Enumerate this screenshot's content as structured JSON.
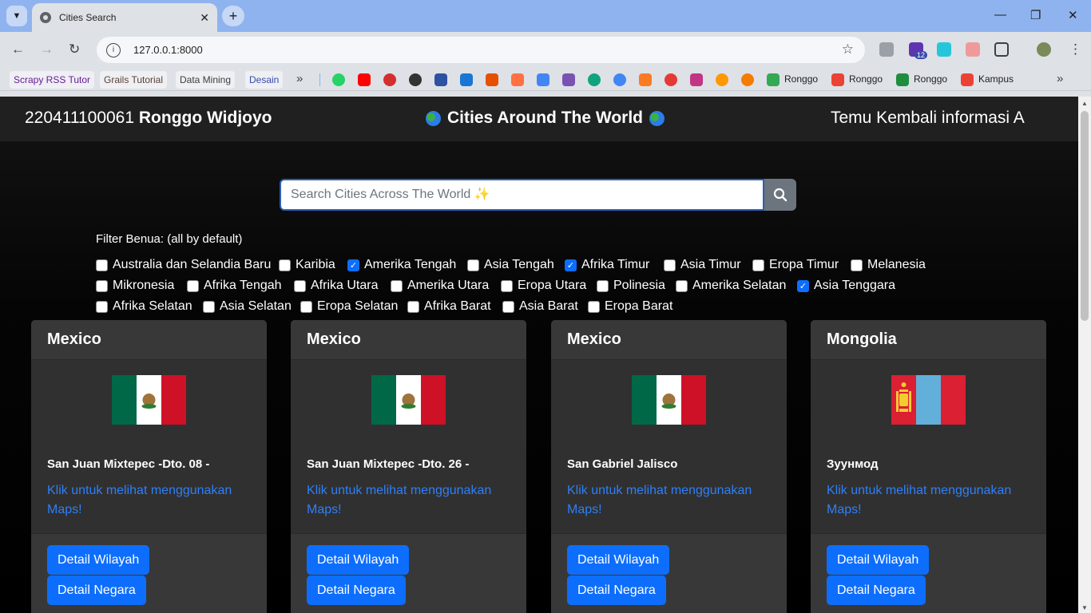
{
  "browser": {
    "tab_title": "Cities Search",
    "url": "127.0.0.1:8000",
    "extension_badge": "12",
    "bookmarks": [
      {
        "label": "Scrapy RSS Tutor",
        "color": "#6a1b9a"
      },
      {
        "label": "Grails Tutorial",
        "color": "#5d4037"
      },
      {
        "label": "Data Mining",
        "color": "#3c4043"
      },
      {
        "label": "Desain",
        "color": "#3949ab"
      }
    ],
    "bookmark_icons": [
      {
        "name": "whatsapp-icon",
        "color": "#25d366"
      },
      {
        "name": "youtube-icon",
        "color": "#ff0000"
      },
      {
        "name": "851-icon",
        "color": "#d32f2f"
      },
      {
        "name": "github-icon",
        "color": "#333333"
      },
      {
        "name": "mal-icon",
        "color": "#2e51a2"
      },
      {
        "name": "blue-app-icon",
        "color": "#1976d2"
      },
      {
        "name": "ppa-icon",
        "color": "#e65100"
      },
      {
        "name": "orange-icon",
        "color": "#ff7043"
      },
      {
        "name": "translate-icon",
        "color": "#4285f4"
      },
      {
        "name": "bootstrap-icon",
        "color": "#7952b3"
      },
      {
        "name": "chatgpt-icon",
        "color": "#10a37f"
      },
      {
        "name": "gemini-icon",
        "color": "#4285f4"
      },
      {
        "name": "xampp-icon",
        "color": "#fb7a24"
      },
      {
        "name": "laravel-icon",
        "color": "#e53935"
      },
      {
        "name": "instagram-icon",
        "color": "#c13584"
      },
      {
        "name": "circles-icon",
        "color": "#ff9800"
      },
      {
        "name": "co-icon",
        "color": "#f57c00"
      }
    ],
    "profile_bookmarks": [
      {
        "label": "Ronggo",
        "icon": "drive-icon",
        "color": "#34a853"
      },
      {
        "label": "Ronggo",
        "icon": "gmail-icon",
        "color": "#ea4335"
      },
      {
        "label": "Ronggo",
        "icon": "classroom-icon",
        "color": "#1e8e3e"
      },
      {
        "label": "Kampus",
        "icon": "gmail-icon",
        "color": "#ea4335"
      }
    ]
  },
  "header": {
    "student_id": "220411100061",
    "student_name": "Ronggo Widjoyo",
    "title": "Cities Around The World",
    "right_text": "Temu Kembali informasi A"
  },
  "search": {
    "placeholder": "Search Cities Across The World ✨"
  },
  "filter": {
    "label": "Filter Benua: (all by default)",
    "options": [
      {
        "label": "Australia dan Selandia Baru",
        "checked": false
      },
      {
        "label": "Karibia",
        "checked": false
      },
      {
        "label": "Amerika Tengah",
        "checked": true
      },
      {
        "label": "Asia Tengah",
        "checked": false
      },
      {
        "label": "Afrika Timur",
        "checked": true
      },
      {
        "label": "Asia Timur",
        "checked": false
      },
      {
        "label": "Eropa Timur",
        "checked": false
      },
      {
        "label": "Melanesia",
        "checked": false
      },
      {
        "label": "Mikronesia",
        "checked": false
      },
      {
        "label": "Afrika Tengah",
        "checked": false
      },
      {
        "label": "Afrika Utara",
        "checked": false
      },
      {
        "label": "Amerika Utara",
        "checked": false
      },
      {
        "label": "Eropa Utara",
        "checked": false
      },
      {
        "label": "Polinesia",
        "checked": false
      },
      {
        "label": "Amerika Selatan",
        "checked": false
      },
      {
        "label": "Asia Tenggara",
        "checked": true
      },
      {
        "label": "Afrika Selatan",
        "checked": false
      },
      {
        "label": "Asia Selatan",
        "checked": false
      },
      {
        "label": "Eropa Selatan",
        "checked": false
      },
      {
        "label": "Afrika Barat",
        "checked": false
      },
      {
        "label": "Asia Barat",
        "checked": false
      },
      {
        "label": "Eropa Barat",
        "checked": false
      }
    ]
  },
  "cards": [
    {
      "country": "Mexico",
      "flag": "mexico-flag",
      "city": "San Juan Mixtepec -Dto. 08 -",
      "map_link": "Klik untuk melihat menggunakan Maps!",
      "btn_region": "Detail Wilayah",
      "btn_country": "Detail Negara"
    },
    {
      "country": "Mexico",
      "flag": "mexico-flag",
      "city": "San Juan Mixtepec -Dto. 26 -",
      "map_link": "Klik untuk melihat menggunakan Maps!",
      "btn_region": "Detail Wilayah",
      "btn_country": "Detail Negara"
    },
    {
      "country": "Mexico",
      "flag": "mexico-flag",
      "city": "San Gabriel Jalisco",
      "map_link": "Klik untuk melihat menggunakan Maps!",
      "btn_region": "Detail Wilayah",
      "btn_country": "Detail Negara"
    },
    {
      "country": "Mongolia",
      "flag": "mongolia-flag",
      "city": "Зуунмод",
      "map_link": "Klik untuk melihat menggunakan Maps!",
      "btn_region": "Detail Wilayah",
      "btn_country": "Detail Negara"
    }
  ],
  "colors": {
    "accent": "#0d6efd",
    "link": "#2d7ff9",
    "card_bg": "#303030",
    "header_bg": "#202020"
  }
}
